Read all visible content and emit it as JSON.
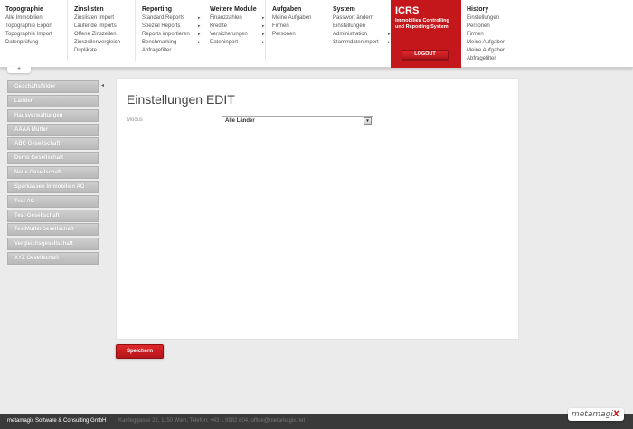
{
  "nav": [
    {
      "title": "Topographie",
      "items": [
        {
          "label": "Alle Immobilien",
          "arrow": false
        },
        {
          "label": "Topographie Export",
          "arrow": false
        },
        {
          "label": "Topographie Import",
          "arrow": false
        },
        {
          "label": "Datenprüfung",
          "arrow": false
        }
      ]
    },
    {
      "title": "Zinslisten",
      "items": [
        {
          "label": "Zinslisten Import",
          "arrow": false
        },
        {
          "label": "Laufende Imports",
          "arrow": false
        },
        {
          "label": "Offene Zinszeilen",
          "arrow": false
        },
        {
          "label": "Zinszeilenvergleich",
          "arrow": false
        },
        {
          "label": "Duplikate",
          "arrow": false
        }
      ]
    },
    {
      "title": "Reporting",
      "items": [
        {
          "label": "Standard Reports",
          "arrow": true
        },
        {
          "label": "Spezial Reports",
          "arrow": true
        },
        {
          "label": "Reports importieren",
          "arrow": true
        },
        {
          "label": "Benchmarking",
          "arrow": true
        },
        {
          "label": "Abfragefilter",
          "arrow": false
        }
      ]
    },
    {
      "title": "Weitere Module",
      "items": [
        {
          "label": "Finanzzahlen",
          "arrow": true
        },
        {
          "label": "Kredite",
          "arrow": true
        },
        {
          "label": "Versicherungen",
          "arrow": true
        },
        {
          "label": "Dateninport",
          "arrow": true
        }
      ]
    },
    {
      "title": "Aufgaben",
      "items": [
        {
          "label": "Meine Aufgaben",
          "arrow": false
        },
        {
          "label": "Firmen",
          "arrow": false
        },
        {
          "label": "Personen",
          "arrow": false
        }
      ]
    },
    {
      "title": "System",
      "items": [
        {
          "label": "Passwort ändern",
          "arrow": false
        },
        {
          "label": "Einstellungen",
          "arrow": false
        },
        {
          "label": "Administration",
          "arrow": true
        },
        {
          "label": "Stammdatenimport",
          "arrow": true
        }
      ]
    },
    {
      "title": "History",
      "items": [
        {
          "label": "Einstellungen",
          "arrow": false
        },
        {
          "label": "Personen",
          "arrow": false
        },
        {
          "label": "Firmen",
          "arrow": false
        },
        {
          "label": "Meine Aufgaben",
          "arrow": false
        },
        {
          "label": "Meine Aufgaben",
          "arrow": false
        },
        {
          "label": "Abfragefilter",
          "arrow": false
        }
      ]
    }
  ],
  "icrs": {
    "brand": "ICRS",
    "subtitle_1": "Immobilien Controlling",
    "subtitle_2": "und Reporting System",
    "logout": "LOGOUT",
    "color": "#c4171b"
  },
  "collapse_symbol": "+",
  "sidebar": {
    "toggle_symbol": "◂",
    "items": [
      "Geschäftsfelder",
      "Länder",
      "Hausverwaltungen",
      "AAAA Mutter",
      "ABC Gesellschaft",
      "Demo Gesellschaft",
      "Neue Gesellschaft",
      "Sparkassen Immobilien AG",
      "Test AG",
      "Test-Gesellschaft",
      "TestMutterGesellschaft",
      "Vergleichsgesellschaft",
      "XYZ Gesellschaft"
    ]
  },
  "main": {
    "title": "Einstellungen EDIT",
    "modus_label": "Modus",
    "modus_value": "Alle Länder",
    "save": "Speichern"
  },
  "footer": {
    "company": "metamagix Software & Consulting GmbH",
    "address": "Kardeggasse 22, 1150 Wien, Telefon: +43 1 9982 804, office@metamagix.net",
    "logo": "metamagi",
    "logo_x": "X"
  }
}
